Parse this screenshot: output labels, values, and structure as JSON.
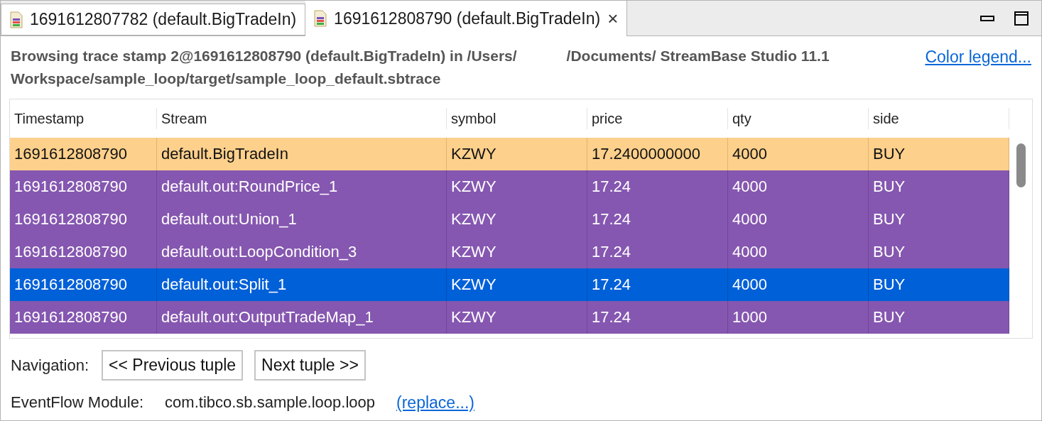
{
  "tabs": [
    {
      "label": "1691612807782 (default.BigTradeIn)",
      "selected": false,
      "closable": false
    },
    {
      "label": "1691612808790 (default.BigTradeIn)",
      "selected": true,
      "closable": true
    }
  ],
  "close_glyph": "×",
  "heading": "Browsing trace stamp 2@1691612808790 (default.BigTradeIn) in /Users/            /Documents/ StreamBase Studio 11.1 Workspace/sample_loop/target/sample_loop_default.sbtrace",
  "legend_link": "Color legend...",
  "table": {
    "columns": [
      "Timestamp",
      "Stream",
      "symbol",
      "price",
      "qty",
      "side"
    ],
    "rows": [
      {
        "kind": "input",
        "selected": false,
        "cells": [
          "1691612808790",
          "default.BigTradeIn",
          "KZWY",
          "17.2400000000",
          "4000",
          "BUY"
        ]
      },
      {
        "kind": "output",
        "selected": false,
        "cells": [
          "1691612808790",
          "default.out:RoundPrice_1",
          "KZWY",
          "17.24",
          "4000",
          "BUY"
        ]
      },
      {
        "kind": "output",
        "selected": false,
        "cells": [
          "1691612808790",
          "default.out:Union_1",
          "KZWY",
          "17.24",
          "4000",
          "BUY"
        ]
      },
      {
        "kind": "output",
        "selected": false,
        "cells": [
          "1691612808790",
          "default.out:LoopCondition_3",
          "KZWY",
          "17.24",
          "4000",
          "BUY"
        ]
      },
      {
        "kind": "output",
        "selected": true,
        "cells": [
          "1691612808790",
          "default.out:Split_1",
          "KZWY",
          "17.24",
          "4000",
          "BUY"
        ]
      },
      {
        "kind": "output",
        "selected": false,
        "cells": [
          "1691612808790",
          "default.out:OutputTradeMap_1",
          "KZWY",
          "17.24",
          "1000",
          "BUY"
        ]
      }
    ]
  },
  "navigation": {
    "label": "Navigation:",
    "buttons": [
      "<< Previous tuple",
      "Next tuple >>"
    ]
  },
  "module": {
    "label": "EventFlow Module:",
    "value": "com.tibco.sb.sample.loop.loop",
    "link": "(replace...)"
  }
}
